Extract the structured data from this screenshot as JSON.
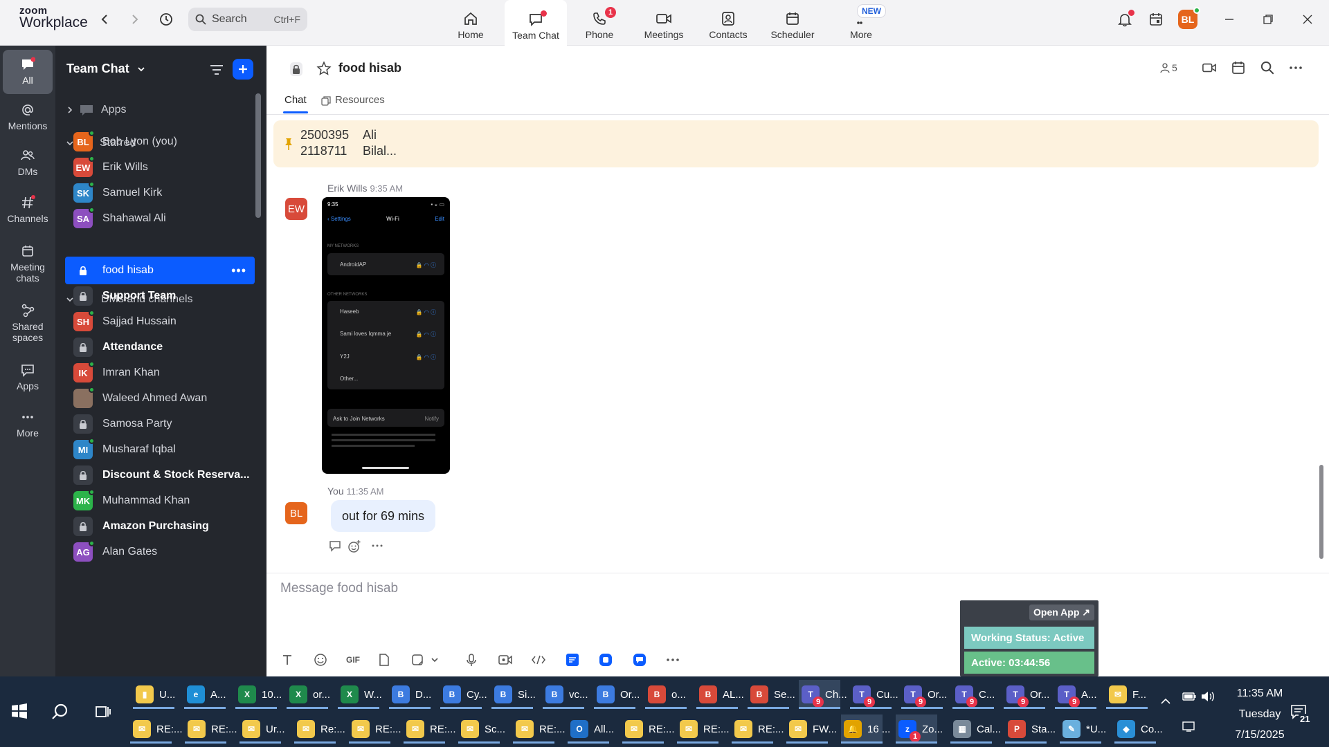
{
  "app": {
    "brand_top": "zoom",
    "brand_bottom": "Workplace"
  },
  "search": {
    "label": "Search",
    "shortcut": "Ctrl+F"
  },
  "tabs": [
    {
      "label": "Home",
      "icon": "home-icon"
    },
    {
      "label": "Team Chat",
      "icon": "chat-icon",
      "active": true
    },
    {
      "label": "Phone",
      "icon": "phone-icon",
      "badge": "1"
    },
    {
      "label": "Meetings",
      "icon": "video-icon"
    },
    {
      "label": "Contacts",
      "icon": "contacts-icon"
    },
    {
      "label": "Scheduler",
      "icon": "calendar-icon"
    },
    {
      "label": "More",
      "icon": "more-icon",
      "pill": "NEW"
    }
  ],
  "profile": {
    "initials": "BL",
    "color": "#e5651c"
  },
  "rail": [
    {
      "label": "All",
      "icon": "chat-bubble-icon",
      "active": true
    },
    {
      "label": "Mentions",
      "icon": "at-icon"
    },
    {
      "label": "DMs",
      "icon": "people-icon"
    },
    {
      "label": "Channels",
      "icon": "hash-icon"
    },
    {
      "label": "Meeting chats",
      "icon": "calendar-icon"
    },
    {
      "label": "Shared spaces",
      "icon": "shared-icon"
    },
    {
      "label": "Apps",
      "icon": "apps-icon"
    },
    {
      "label": "More",
      "icon": "more-icon"
    }
  ],
  "sidebar": {
    "title": "Team Chat",
    "apps_label": "Apps",
    "starred_label": "Starred",
    "dms_label": "DMs and channels",
    "starred": [
      {
        "name": "Bob Lyon (you)",
        "initials": "BL",
        "color": "#e5651c",
        "online": true
      },
      {
        "name": "Erik Wills",
        "initials": "EW",
        "color": "#d84a3a",
        "online": true
      },
      {
        "name": "Samuel Kirk",
        "initials": "SK",
        "color": "#2e86c8",
        "online": true
      },
      {
        "name": "Shahawal Ali",
        "initials": "SA",
        "color": "#8d4fbf",
        "online": true
      }
    ],
    "items": [
      {
        "name": "food hisab",
        "type": "channel",
        "selected": true,
        "more": "•••"
      },
      {
        "name": "Support Team",
        "type": "channel",
        "bold": true
      },
      {
        "name": "Sajjad Hussain",
        "initials": "SH",
        "color": "#d84a3a",
        "online": true
      },
      {
        "name": "Attendance",
        "type": "channel",
        "bold": true
      },
      {
        "name": "Imran Khan",
        "initials": "IK",
        "color": "#d84a3a",
        "online": true
      },
      {
        "name": "Waleed Ahmed Awan",
        "initials": "",
        "color": "#8a7060",
        "online": true,
        "photo": true
      },
      {
        "name": "Samosa Party",
        "type": "channel"
      },
      {
        "name": "Musharaf Iqbal",
        "initials": "MI",
        "color": "#2e86c8",
        "online": true
      },
      {
        "name": "Discount & Stock Reserva...",
        "type": "channel",
        "bold": true
      },
      {
        "name": "Muhammad Khan",
        "initials": "MK",
        "color": "#2cb34a",
        "online": true
      },
      {
        "name": "Amazon Purchasing",
        "type": "channel",
        "bold": true
      },
      {
        "name": "Alan Gates",
        "initials": "AG",
        "color": "#8d4fbf",
        "online": true
      }
    ]
  },
  "channel": {
    "title": "food hisab",
    "member_count": "5",
    "tabs": [
      "Chat",
      "Resources"
    ],
    "pinned": {
      "lines": [
        [
          "2500395",
          "Ali"
        ],
        [
          "2118711",
          "Bilal..."
        ]
      ]
    },
    "messages": [
      {
        "author": "Erik Wills",
        "time": "9:35 AM",
        "initials": "EW",
        "color": "#d84a3a",
        "image": {
          "time": "9:35",
          "back": "Settings",
          "title": "Wi-Fi",
          "edit": "Edit",
          "my_networks": "MY NETWORKS",
          "my": [
            "AndroidAP"
          ],
          "other_networks": "OTHER NETWORKS",
          "others": [
            "Haseeb",
            "Sami loves Iqmma je",
            "Y2J",
            "Other..."
          ],
          "ask": "Ask to Join Networks",
          "notify": "Notify"
        }
      },
      {
        "author": "You",
        "time": "11:35 AM",
        "initials": "BL",
        "color": "#e5651c",
        "text": "out for 69 mins"
      }
    ],
    "composer_placeholder": "Message food hisab",
    "toolbar": {
      "gif": "GIF"
    }
  },
  "status_widget": {
    "open_app": "Open App ↗",
    "working_status": "Working Status: Active",
    "active_time": "Active: 03:44:56"
  },
  "taskbar": {
    "row1": [
      {
        "label": "U...",
        "color": "#f2c94c",
        "glyph": "▮"
      },
      {
        "label": "A...",
        "color": "#1f8fd6",
        "glyph": "e"
      },
      {
        "label": "10...",
        "color": "#1f8a4c",
        "glyph": "X"
      },
      {
        "label": "or...",
        "color": "#1f8a4c",
        "glyph": "X"
      },
      {
        "label": "W...",
        "color": "#1f8a4c",
        "glyph": "X"
      },
      {
        "label": "D...",
        "color": "#3c7be0",
        "glyph": "B"
      },
      {
        "label": "Cy...",
        "color": "#3c7be0",
        "glyph": "B"
      },
      {
        "label": "Si...",
        "color": "#3c7be0",
        "glyph": "B"
      },
      {
        "label": "vc...",
        "color": "#3c7be0",
        "glyph": "B"
      },
      {
        "label": "Or...",
        "color": "#3c7be0",
        "glyph": "B"
      },
      {
        "label": "o...",
        "color": "#d84a3a",
        "glyph": "B"
      },
      {
        "label": "AL...",
        "color": "#d84a3a",
        "glyph": "B"
      },
      {
        "label": "Se...",
        "color": "#d84a3a",
        "glyph": "B"
      },
      {
        "label": "Ch...",
        "color": "#5b5fc7",
        "glyph": "T",
        "active": true,
        "badge": "9"
      },
      {
        "label": "Cu...",
        "color": "#5b5fc7",
        "glyph": "T",
        "badge": "9"
      },
      {
        "label": "Or...",
        "color": "#5b5fc7",
        "glyph": "T",
        "badge": "9"
      },
      {
        "label": "C...",
        "color": "#5b5fc7",
        "glyph": "T",
        "badge": "9"
      },
      {
        "label": "Or...",
        "color": "#5b5fc7",
        "glyph": "T",
        "badge": "9"
      },
      {
        "label": "A...",
        "color": "#5b5fc7",
        "glyph": "T",
        "badge": "9"
      },
      {
        "label": "F...",
        "color": "#f2c94c",
        "glyph": "✉"
      }
    ],
    "row2": [
      {
        "label": "RE:...",
        "color": "#f2c94c",
        "glyph": "✉"
      },
      {
        "label": "RE:...",
        "color": "#f2c94c",
        "glyph": "✉"
      },
      {
        "label": "Ur...",
        "color": "#f2c94c",
        "glyph": "✉"
      },
      {
        "label": "Re:...",
        "color": "#f2c94c",
        "glyph": "✉"
      },
      {
        "label": "RE:...",
        "color": "#f2c94c",
        "glyph": "✉"
      },
      {
        "label": "RE:...",
        "color": "#f2c94c",
        "glyph": "✉"
      },
      {
        "label": "Sc...",
        "color": "#f2c94c",
        "glyph": "✉"
      },
      {
        "label": "RE:...",
        "color": "#f2c94c",
        "glyph": "✉"
      },
      {
        "label": "All...",
        "color": "#1f6fc7",
        "glyph": "O"
      },
      {
        "label": "RE:...",
        "color": "#f2c94c",
        "glyph": "✉"
      },
      {
        "label": "RE:...",
        "color": "#f2c94c",
        "glyph": "✉"
      },
      {
        "label": "RE:...",
        "color": "#f2c94c",
        "glyph": "✉"
      },
      {
        "label": "FW...",
        "color": "#f2c94c",
        "glyph": "✉"
      },
      {
        "label": "16 ...",
        "color": "#e2a300",
        "glyph": "🔔",
        "active": true
      },
      {
        "label": "Zo...",
        "color": "#0b5cff",
        "glyph": "z",
        "badge": "1",
        "active": true
      },
      {
        "label": "Cal...",
        "color": "#7a8a9a",
        "glyph": "▦"
      },
      {
        "label": "Sta...",
        "color": "#d84a3a",
        "glyph": "P"
      },
      {
        "label": "*U...",
        "color": "#6ab0de",
        "glyph": "✎"
      },
      {
        "label": "Co...",
        "color": "#2a8fd6",
        "glyph": "◆"
      }
    ],
    "clock": {
      "time": "11:35 AM",
      "day": "Tuesday",
      "date": "7/15/2025"
    },
    "notif_count": "21"
  }
}
